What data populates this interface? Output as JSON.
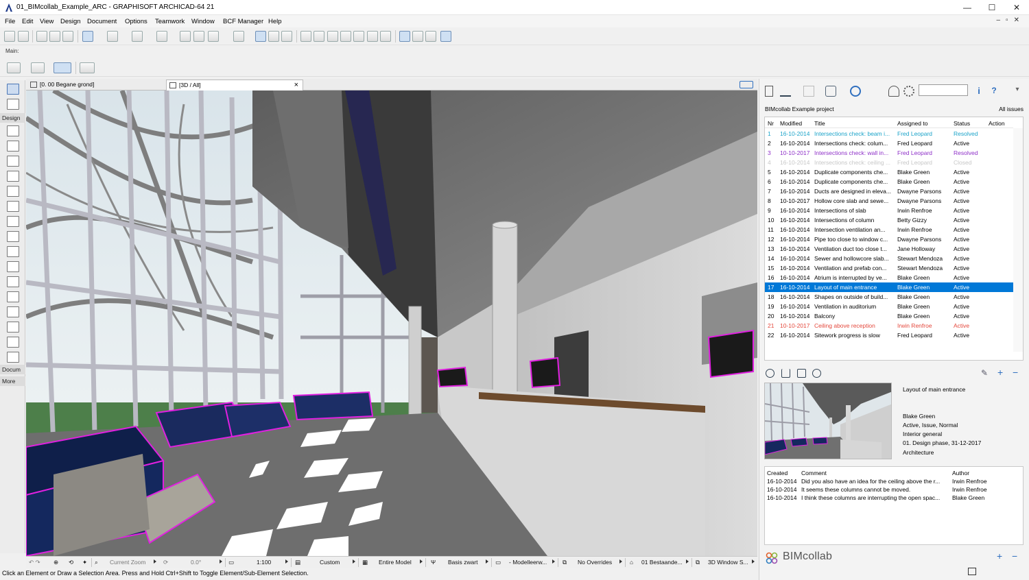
{
  "window": {
    "title": "01_BIMcollab_Example_ARC - GRAPHISOFT ARCHICAD-64 21",
    "minimize": "—",
    "maximize": "☐",
    "close": "✕"
  },
  "menu": [
    "File",
    "Edit",
    "View",
    "Design",
    "Document",
    "Options",
    "Teamwork",
    "Window",
    "BCF Manager",
    "Help"
  ],
  "toolbar": {
    "main_label": "Main:"
  },
  "toolbox": {
    "design_label": "Design",
    "docum_label": "Docum",
    "more_label": "More"
  },
  "tabs": {
    "floorplan": "[0. 00 Begane grond]",
    "view3d": "[3D / All]",
    "close": "×"
  },
  "statusbar": {
    "zoom": "Current Zoom",
    "angle": "0.0°",
    "scale": "1:100",
    "layer_combo": "Custom",
    "model": "Entire Model",
    "pen_set": "Basis zwart",
    "model_view": "- Modelleerw...",
    "overrides": "No Overrides",
    "renovation": "01 Bestaande...",
    "window_settings": "3D Window S...",
    "hint": "Click an Element or Draw a Selection Area. Press and Hold Ctrl+Shift to Toggle Element/Sub-Element Selection."
  },
  "bcf": {
    "project": "BIMcollab Example project",
    "filter": "All issues",
    "columns": {
      "nr": "Nr",
      "modified": "Modified",
      "title": "Title",
      "assigned": "Assigned to",
      "status": "Status",
      "action": "Action"
    },
    "issues": [
      {
        "nr": "1",
        "modified": "16-10-2014",
        "title": "Intersections check: beam i...",
        "assigned": "Fred Leopard",
        "status": "Resolved",
        "style": "resolved"
      },
      {
        "nr": "2",
        "modified": "16-10-2014",
        "title": "Intersections check: colum...",
        "assigned": "Fred Leopard",
        "status": "Active",
        "style": ""
      },
      {
        "nr": "3",
        "modified": "10-10-2017",
        "title": "Intersections check: wall in...",
        "assigned": "Fred Leopard",
        "status": "Resolved",
        "style": "purple"
      },
      {
        "nr": "4",
        "modified": "16-10-2014",
        "title": "Intersections check: ceiling ...",
        "assigned": "Fred Leopard",
        "status": "Closed",
        "style": "closed"
      },
      {
        "nr": "5",
        "modified": "16-10-2014",
        "title": "Duplicate components che...",
        "assigned": "Blake Green",
        "status": "Active",
        "style": ""
      },
      {
        "nr": "6",
        "modified": "16-10-2014",
        "title": "Duplicate components che...",
        "assigned": "Blake Green",
        "status": "Active",
        "style": ""
      },
      {
        "nr": "7",
        "modified": "16-10-2014",
        "title": "Ducts are designed in eleva...",
        "assigned": "Dwayne Parsons",
        "status": "Active",
        "style": ""
      },
      {
        "nr": "8",
        "modified": "10-10-2017",
        "title": "Hollow core slab and sewe...",
        "assigned": "Dwayne Parsons",
        "status": "Active",
        "style": ""
      },
      {
        "nr": "9",
        "modified": "16-10-2014",
        "title": "Intersections of slab",
        "assigned": "Irwin Renfroe",
        "status": "Active",
        "style": ""
      },
      {
        "nr": "10",
        "modified": "16-10-2014",
        "title": "Intersections of column",
        "assigned": "Betty Gizzy",
        "status": "Active",
        "style": ""
      },
      {
        "nr": "11",
        "modified": "16-10-2014",
        "title": "Intersection ventilation an...",
        "assigned": "Irwin Renfroe",
        "status": "Active",
        "style": ""
      },
      {
        "nr": "12",
        "modified": "16-10-2014",
        "title": "Pipe too close to window c...",
        "assigned": "Dwayne Parsons",
        "status": "Active",
        "style": ""
      },
      {
        "nr": "13",
        "modified": "16-10-2014",
        "title": "Ventilation duct too close t...",
        "assigned": "Jane Holloway",
        "status": "Active",
        "style": ""
      },
      {
        "nr": "14",
        "modified": "16-10-2014",
        "title": "Sewer and hollowcore slab...",
        "assigned": "Stewart Mendoza",
        "status": "Active",
        "style": ""
      },
      {
        "nr": "15",
        "modified": "16-10-2014",
        "title": "Ventilation and prefab con...",
        "assigned": "Stewart Mendoza",
        "status": "Active",
        "style": ""
      },
      {
        "nr": "16",
        "modified": "16-10-2014",
        "title": "Atrium is interrupted by ve...",
        "assigned": "Blake Green",
        "status": "Active",
        "style": ""
      },
      {
        "nr": "17",
        "modified": "16-10-2014",
        "title": "Layout of main entrance",
        "assigned": "Blake Green",
        "status": "Active",
        "style": "selected"
      },
      {
        "nr": "18",
        "modified": "16-10-2014",
        "title": "Shapes on outside of build...",
        "assigned": "Blake Green",
        "status": "Active",
        "style": ""
      },
      {
        "nr": "19",
        "modified": "16-10-2014",
        "title": "Ventilation in auditorium",
        "assigned": "Blake Green",
        "status": "Active",
        "style": ""
      },
      {
        "nr": "20",
        "modified": "16-10-2014",
        "title": "Balcony",
        "assigned": "Blake Green",
        "status": "Active",
        "style": ""
      },
      {
        "nr": "21",
        "modified": "10-10-2017",
        "title": "Ceiling above reception",
        "assigned": "Irwin Renfroe",
        "status": "Active",
        "style": "red"
      },
      {
        "nr": "22",
        "modified": "16-10-2014",
        "title": "Sitework progress is slow",
        "assigned": "Fred Leopard",
        "status": "Active",
        "style": ""
      }
    ],
    "detail": {
      "title": "Layout of main entrance",
      "assigned": "Blake Green",
      "status_line": "Active, Issue, Normal",
      "area": "Interior general",
      "milestone": "01. Design phase, 31-12-2017",
      "discipline": "Architecture"
    },
    "comment_columns": {
      "created": "Created",
      "comment": "Comment",
      "author": "Author"
    },
    "comments": [
      {
        "created": "16-10-2014",
        "comment": "Did you also have an idea for the ceiling above the r...",
        "author": "Irwin Renfroe"
      },
      {
        "created": "16-10-2014",
        "comment": "It seems these columns cannot be moved.",
        "author": "Irwin Renfroe"
      },
      {
        "created": "16-10-2014",
        "comment": "I think these columns are interrupting the open spac...",
        "author": "Blake Green"
      }
    ],
    "brand": "BIMcollab",
    "colors": {
      "selected": "#0078d7",
      "resolved": "#1aa3c9",
      "purple": "#8e2fc8",
      "red": "#e4473b",
      "magenta": "#e020e0"
    }
  }
}
